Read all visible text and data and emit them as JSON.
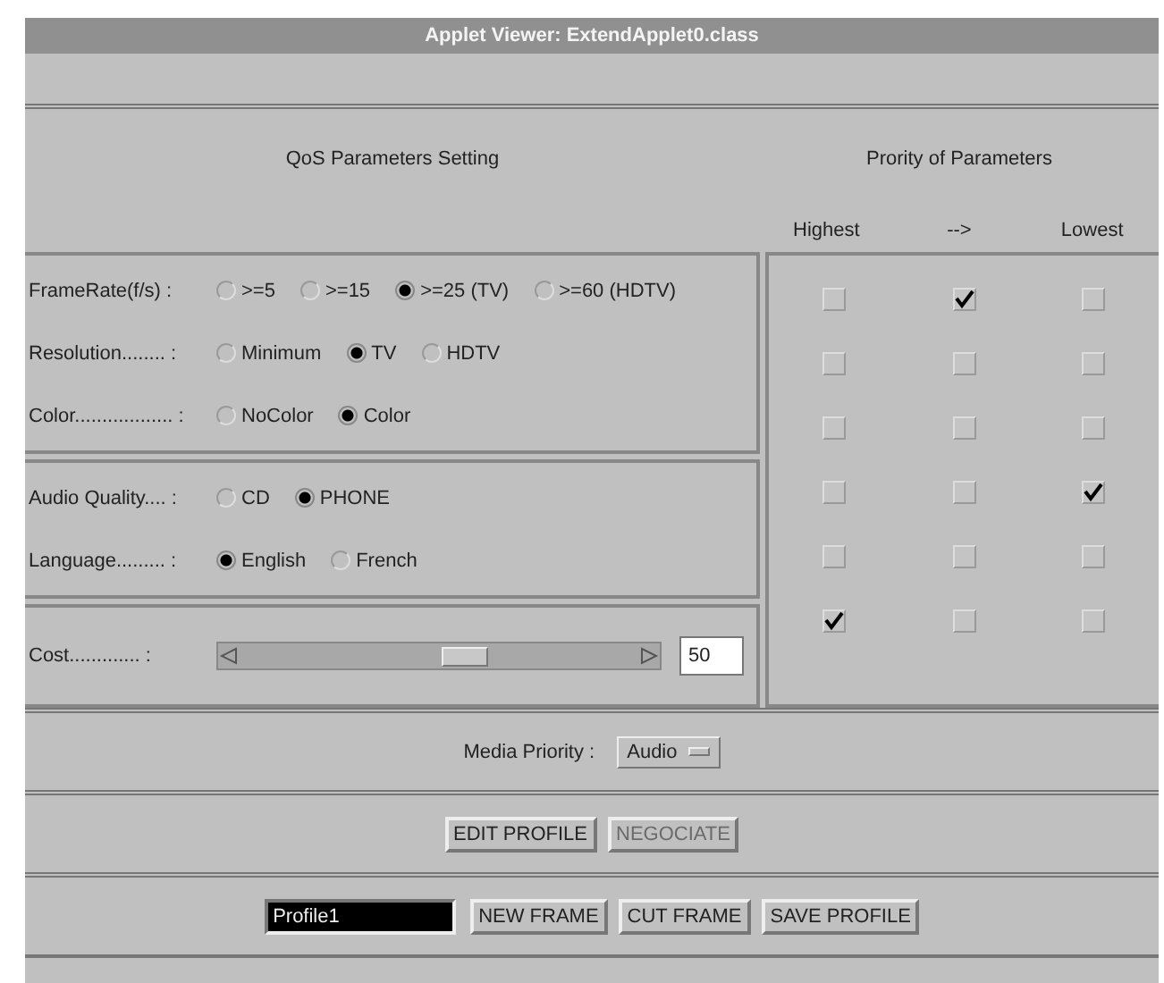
{
  "window": {
    "title": "Applet Viewer: ExtendApplet0.class"
  },
  "qos": {
    "title": "QoS Parameters Setting",
    "groups": [
      {
        "rows": [
          {
            "label": "FrameRate(f/s) :",
            "options": [
              {
                "label": ">=5",
                "selected": false
              },
              {
                "label": ">=15",
                "selected": false
              },
              {
                "label": ">=25 (TV)",
                "selected": true
              },
              {
                "label": ">=60 (HDTV)",
                "selected": false
              }
            ]
          },
          {
            "label": "Resolution........ :",
            "options": [
              {
                "label": "Minimum",
                "selected": false
              },
              {
                "label": "TV",
                "selected": true
              },
              {
                "label": "HDTV",
                "selected": false
              }
            ]
          },
          {
            "label": "Color.................. :",
            "options": [
              {
                "label": "NoColor",
                "selected": false
              },
              {
                "label": "Color",
                "selected": true
              }
            ]
          }
        ]
      },
      {
        "rows": [
          {
            "label": "Audio Quality.... :",
            "options": [
              {
                "label": "CD",
                "selected": false
              },
              {
                "label": "PHONE",
                "selected": true
              }
            ]
          },
          {
            "label": "Language......... :",
            "options": [
              {
                "label": "English",
                "selected": true
              },
              {
                "label": "French",
                "selected": false
              }
            ]
          }
        ]
      }
    ],
    "cost": {
      "label": "Cost............. :",
      "level": 0.56,
      "value": "50"
    }
  },
  "priority": {
    "title": "Prority of Parameters",
    "columns": [
      "Highest",
      "-->",
      "Lowest"
    ],
    "rows": [
      {
        "checks": [
          {
            "checked": false
          },
          {
            "checked": true
          },
          {
            "checked": false
          }
        ]
      },
      {
        "checks": [
          {
            "checked": false
          },
          {
            "checked": false
          },
          {
            "checked": false
          }
        ]
      },
      {
        "checks": [
          {
            "checked": false
          },
          {
            "checked": false
          },
          {
            "checked": false
          }
        ]
      },
      {
        "checks": [
          {
            "checked": false
          },
          {
            "checked": false
          },
          {
            "checked": true
          }
        ]
      },
      {
        "checks": [
          {
            "checked": false
          },
          {
            "checked": false
          },
          {
            "checked": false
          }
        ]
      },
      {
        "checks": [
          {
            "checked": true
          },
          {
            "checked": false
          },
          {
            "checked": false
          }
        ]
      }
    ]
  },
  "media_priority": {
    "label": "Media Priority :",
    "value": "Audio"
  },
  "profile_buttons": [
    {
      "label": "EDIT PROFILE",
      "disabled": false
    },
    {
      "label": "NEGOCIATE",
      "disabled": true
    }
  ],
  "profile": {
    "name": "Profile1",
    "highlighted": true,
    "buttons": [
      "NEW FRAME",
      "CUT FRAME",
      "SAVE PROFILE"
    ]
  }
}
